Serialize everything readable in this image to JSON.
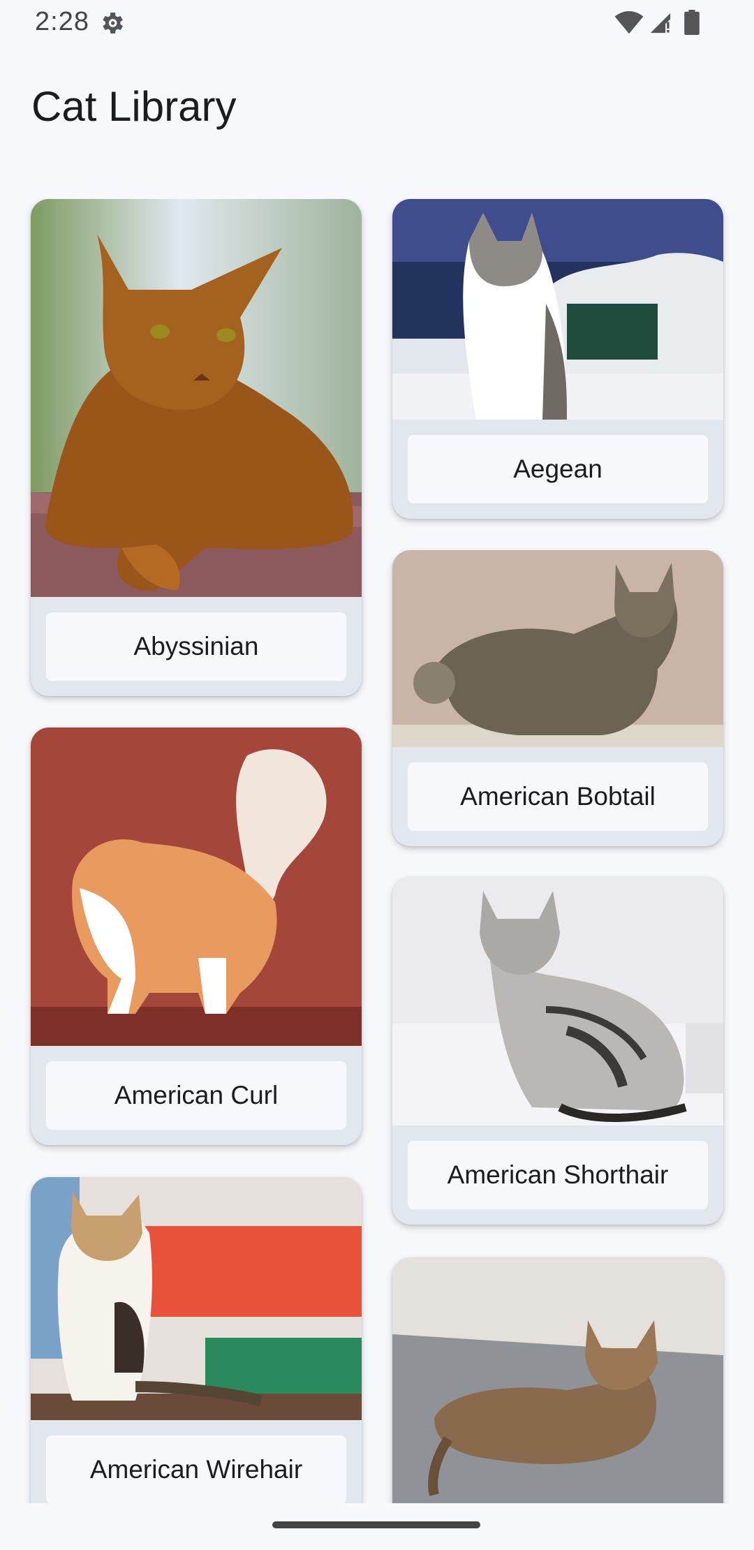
{
  "status_bar": {
    "time": "2:28",
    "icons": [
      "settings-gear-icon",
      "wifi-icon",
      "cell-signal-icon",
      "battery-icon"
    ]
  },
  "app_bar": {
    "title": "Cat Library"
  },
  "cats": [
    {
      "name": "Abyssinian",
      "image": "abyssinian-cat-photo"
    },
    {
      "name": "Aegean",
      "image": "aegean-cat-photo"
    },
    {
      "name": "American Bobtail",
      "image": "american-bobtail-cat-photo"
    },
    {
      "name": "American Curl",
      "image": "american-curl-cat-photo"
    },
    {
      "name": "American Shorthair",
      "image": "american-shorthair-cat-photo"
    },
    {
      "name": "American Wirehair",
      "image": "american-wirehair-cat-photo"
    },
    {
      "name": "",
      "image": "cat-photo-partially-visible"
    }
  ],
  "colors": {
    "background": "#f6f8fc",
    "card_background": "#e2e7ed",
    "label_background": "#f6f8fc",
    "text": "#1c1c1f"
  }
}
